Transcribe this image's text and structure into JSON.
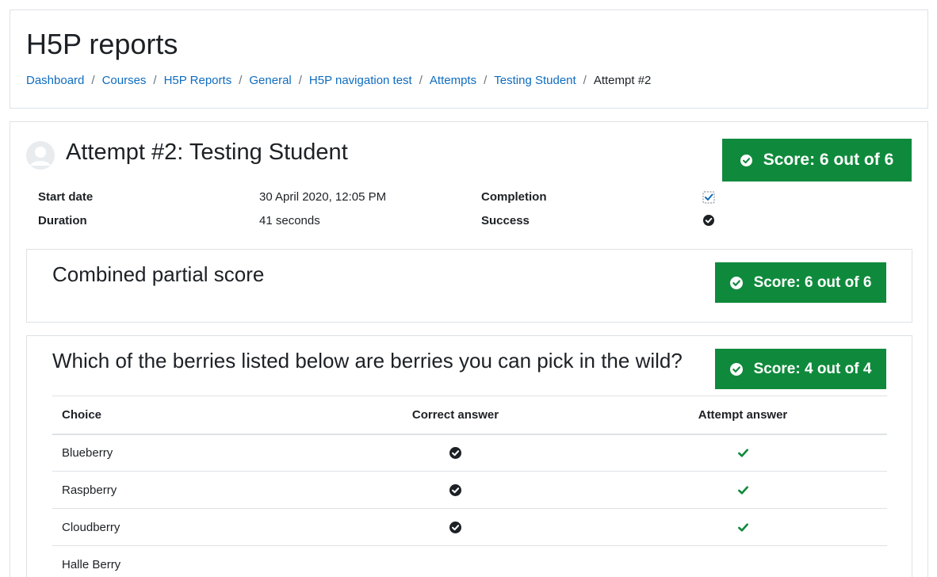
{
  "page": {
    "title": "H5P reports"
  },
  "breadcrumb": {
    "items": [
      {
        "label": "Dashboard"
      },
      {
        "label": "Courses"
      },
      {
        "label": "H5P Reports"
      },
      {
        "label": "General"
      },
      {
        "label": "H5P navigation test"
      },
      {
        "label": "Attempts"
      },
      {
        "label": "Testing Student"
      }
    ],
    "separator": "/",
    "current": "Attempt #2"
  },
  "attempt": {
    "title": "Attempt #2: Testing Student",
    "score_label": "Score: 6 out of 6",
    "start_date_label": "Start date",
    "start_date_value": "30 April 2020, 12:05 PM",
    "duration_label": "Duration",
    "duration_value": "41 seconds",
    "completion_label": "Completion",
    "completion_icon": "checked-checkbox-icon",
    "success_label": "Success",
    "success_icon": "check-circle-icon"
  },
  "sections": [
    {
      "title": "Combined partial score",
      "score_label": "Score: 6 out of 6"
    },
    {
      "title": "Which of the berries listed below are berries you can pick in the wild?",
      "score_label": "Score: 4 out of 4",
      "table": {
        "headers": [
          "Choice",
          "Correct answer",
          "Attempt answer"
        ],
        "rows": [
          {
            "choice": "Blueberry",
            "correct": true,
            "attempt": true
          },
          {
            "choice": "Raspberry",
            "correct": true,
            "attempt": true
          },
          {
            "choice": "Cloudberry",
            "correct": true,
            "attempt": true
          },
          {
            "choice": "Halle Berry",
            "correct": false,
            "attempt": false
          }
        ]
      }
    }
  ],
  "colors": {
    "accent": "#0f6cbf",
    "success": "#0f8a3c",
    "text": "#1d2125"
  }
}
